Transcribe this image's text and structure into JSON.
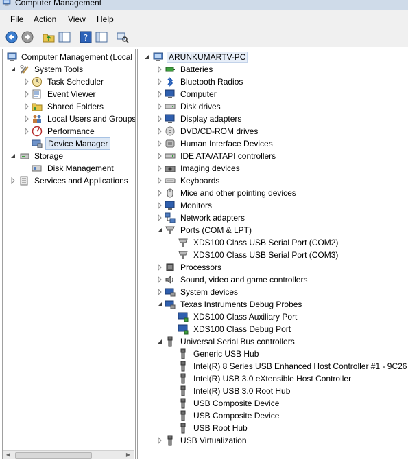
{
  "window": {
    "title": "Computer Management"
  },
  "menu": {
    "file": "File",
    "action": "Action",
    "view": "View",
    "help": "Help"
  },
  "left_tree": {
    "root": "Computer Management (Local",
    "system_tools": "System Tools",
    "task_scheduler": "Task Scheduler",
    "event_viewer": "Event Viewer",
    "shared_folders": "Shared Folders",
    "local_users": "Local Users and Groups",
    "performance": "Performance",
    "device_manager": "Device Manager",
    "storage": "Storage",
    "disk_management": "Disk Management",
    "services": "Services and Applications"
  },
  "device_tree": {
    "computer_name": "ARUNKUMARTV-PC",
    "batteries": "Batteries",
    "bluetooth": "Bluetooth Radios",
    "computer": "Computer",
    "disk_drives": "Disk drives",
    "display": "Display adapters",
    "dvd": "DVD/CD-ROM drives",
    "hid": "Human Interface Devices",
    "ide": "IDE ATA/ATAPI controllers",
    "imaging": "Imaging devices",
    "keyboards": "Keyboards",
    "mice": "Mice and other pointing devices",
    "monitors": "Monitors",
    "network": "Network adapters",
    "ports": "Ports (COM & LPT)",
    "port_com2": "XDS100 Class USB Serial Port (COM2)",
    "port_com3": "XDS100 Class USB Serial Port (COM3)",
    "processors": "Processors",
    "sound": "Sound, video and game controllers",
    "system_devices": "System devices",
    "ti_probes": "Texas Instruments Debug Probes",
    "ti_aux": "XDS100 Class Auxiliary Port",
    "ti_debug": "XDS100 Class Debug Port",
    "usb": "Universal Serial Bus controllers",
    "usb_generic_hub": "Generic USB Hub",
    "usb_intel_ehc": "Intel(R) 8 Series USB Enhanced Host Controller #1 - 9C26",
    "usb_intel_xhc": "Intel(R) USB 3.0 eXtensible Host Controller",
    "usb_intel_root": "Intel(R) USB 3.0 Root Hub",
    "usb_composite_1": "USB Composite Device",
    "usb_composite_2": "USB Composite Device",
    "usb_root_hub": "USB Root Hub",
    "usb_virtualization": "USB Virtualization"
  }
}
